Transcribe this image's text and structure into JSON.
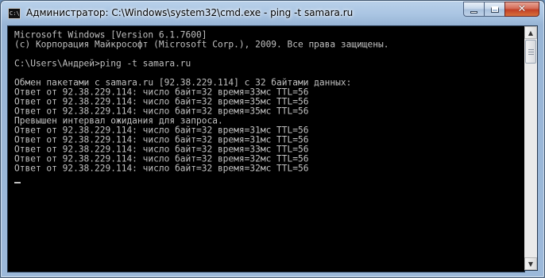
{
  "window": {
    "title": "Администратор: C:\\Windows\\system32\\cmd.exe - ping  -t samara.ru",
    "app_icon_text": "C:\\",
    "controls": {
      "minimize": "minimize",
      "maximize": "maximize",
      "close": "✕"
    }
  },
  "console": {
    "lines": [
      "Microsoft Windows [Version 6.1.7600]",
      "(c) Корпорация Майкрософт (Microsoft Corp.), 2009. Все права защищены.",
      "",
      "C:\\Users\\Андрей>ping -t samara.ru",
      "",
      "Обмен пакетами с samara.ru [92.38.229.114] с 32 байтами данных:",
      "Ответ от 92.38.229.114: число байт=32 время=33мс TTL=56",
      "Ответ от 92.38.229.114: число байт=32 время=35мс TTL=56",
      "Ответ от 92.38.229.114: число байт=32 время=35мс TTL=56",
      "Превышен интервал ожидания для запроса.",
      "Ответ от 92.38.229.114: число байт=32 время=31мс TTL=56",
      "Ответ от 92.38.229.114: число байт=32 время=31мс TTL=56",
      "Ответ от 92.38.229.114: число байт=32 время=33мс TTL=56",
      "Ответ от 92.38.229.114: число байт=32 время=32мс TTL=56",
      "Ответ от 92.38.229.114: число байт=32 время=32мс TTL=56"
    ]
  },
  "scrollbar": {
    "up_icon": "▲",
    "down_icon": "▼"
  },
  "colors": {
    "console_bg": "#000000",
    "console_text": "#c0c0c0",
    "close_button": "#c94a30"
  }
}
